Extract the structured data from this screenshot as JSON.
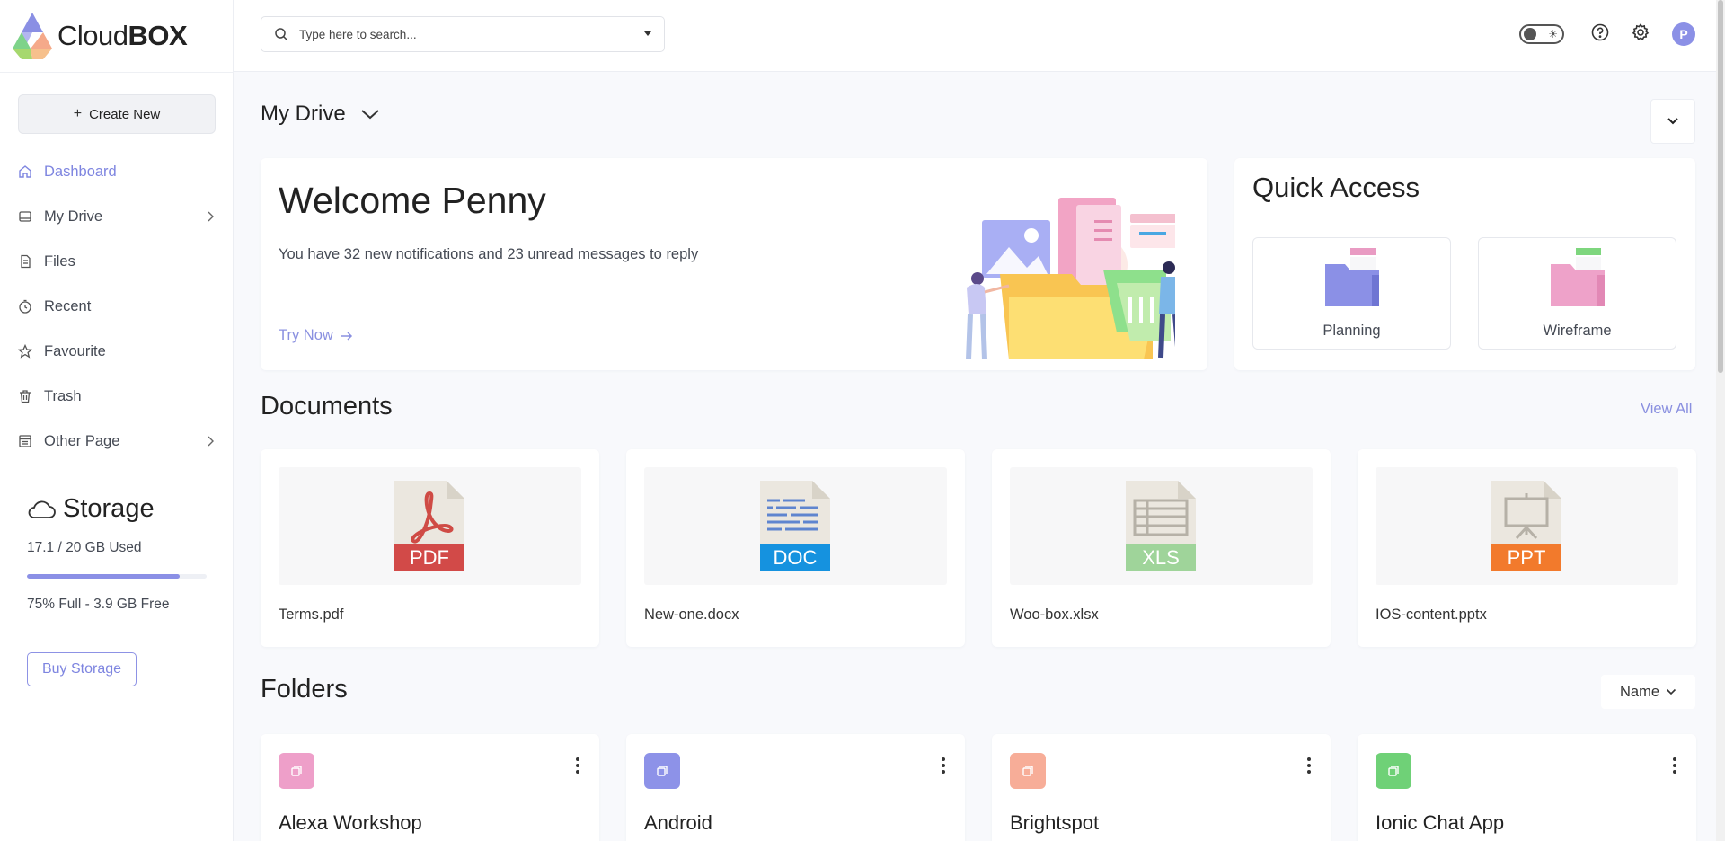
{
  "app": {
    "logo_main": "Cloud",
    "logo_bold": "BOX"
  },
  "sidebar": {
    "create_label": "Create New",
    "items": [
      {
        "label": "Dashboard",
        "icon": "home-icon",
        "active": true
      },
      {
        "label": "My Drive",
        "icon": "drive-icon",
        "has_submenu": true
      },
      {
        "label": "Files",
        "icon": "file-icon"
      },
      {
        "label": "Recent",
        "icon": "clock-icon"
      },
      {
        "label": "Favourite",
        "icon": "star-icon"
      },
      {
        "label": "Trash",
        "icon": "trash-icon"
      },
      {
        "label": "Other Page",
        "icon": "page-icon",
        "has_submenu": true
      }
    ],
    "storage": {
      "title": "Storage",
      "used_text": "17.1 / 20 GB Used",
      "fill_percent": 85,
      "free_text": "75% Full - 3.9 GB Free",
      "buy_label": "Buy Storage"
    }
  },
  "header": {
    "search_placeholder": "Type here to search...",
    "avatar_initial": "P"
  },
  "main": {
    "drive_title": "My Drive",
    "welcome": {
      "title": "Welcome Penny",
      "message": "You have 32 new notifications and 23 unread messages to reply",
      "cta": "Try Now"
    },
    "quick_access": {
      "title": "Quick Access",
      "items": [
        {
          "label": "Planning",
          "color": "#8b90e6",
          "tab": "#e99bc3"
        },
        {
          "label": "Wireframe",
          "color": "#eea2c9",
          "tab": "#7ed67e"
        }
      ]
    },
    "documents": {
      "title": "Documents",
      "view_all": "View All",
      "items": [
        {
          "name": "Terms.pdf",
          "type": "PDF",
          "color": "#d24a48"
        },
        {
          "name": "New-one.docx",
          "type": "DOC",
          "color": "#1592df"
        },
        {
          "name": "Woo-box.xlsx",
          "type": "XLS",
          "color": "#9fd49a"
        },
        {
          "name": "IOS-content.pptx",
          "type": "PPT",
          "color": "#f27a2c"
        }
      ]
    },
    "folders": {
      "title": "Folders",
      "sort_label": "Name",
      "items": [
        {
          "name": "Alexa Workshop",
          "color": "#ee9fc9"
        },
        {
          "name": "Android",
          "color": "#8d92e8"
        },
        {
          "name": "Brightspot",
          "color": "#f7ad98"
        },
        {
          "name": "Ionic Chat App",
          "color": "#6fd177"
        }
      ]
    }
  },
  "colors": {
    "accent": "#8a90e0"
  }
}
